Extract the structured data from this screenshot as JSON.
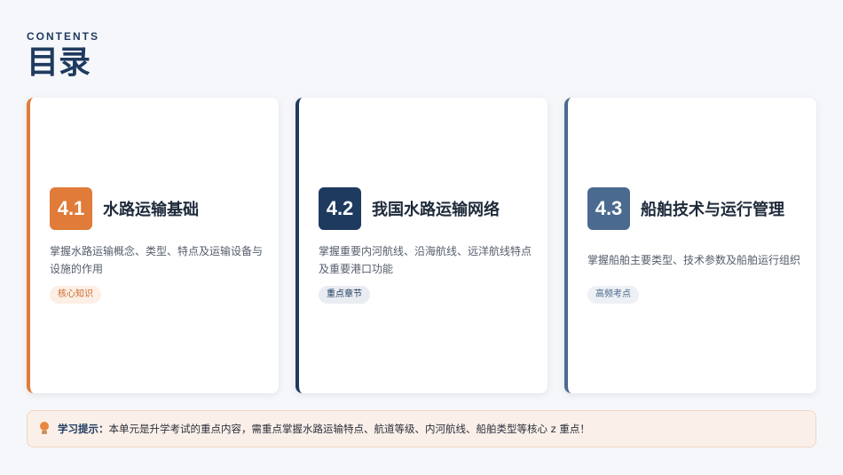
{
  "header": {
    "subtitle": "CONTENTS",
    "title": "目录"
  },
  "cards": [
    {
      "number": "4.1",
      "title": "水路运输基础",
      "description": "掌握水路运输概念、类型、特点及运输设备与设施的作用",
      "tag": "核心知识",
      "accent": "#e07b39"
    },
    {
      "number": "4.2",
      "title": "我国水路运输网络",
      "description": "掌握重要内河航线、沿海航线、远洋航线特点及重要港口功能",
      "tag": "重点章节",
      "accent": "#1e3a5f"
    },
    {
      "number": "4.3",
      "title": "船舶技术与运行管理",
      "description": "掌握船舶主要类型、技术参数及船舶运行组织",
      "tag": "高频考点",
      "accent": "#4a6a8f"
    }
  ],
  "tip": {
    "icon": "lightbulb-icon",
    "label": "学习提示：",
    "text": "本单元是升学考试的重点内容，需重点掌握水路运输特点、航道等级、内河航线、船舶类型等核心 z 重点！"
  }
}
